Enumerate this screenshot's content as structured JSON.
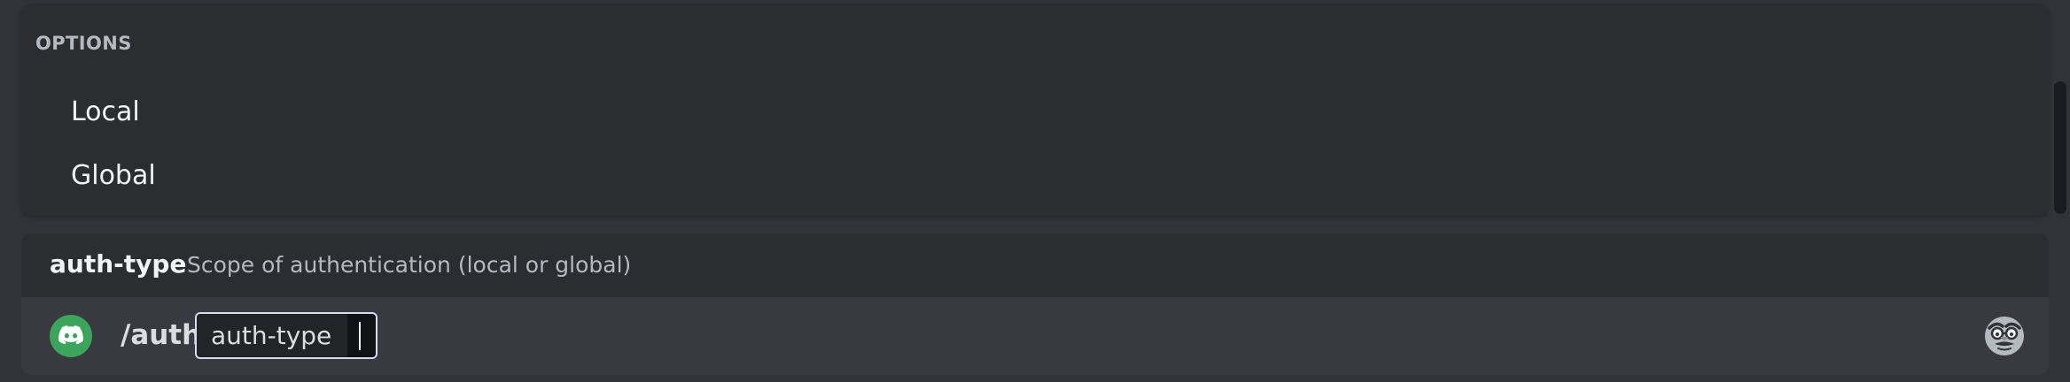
{
  "options": {
    "header": "OPTIONS",
    "items": [
      {
        "label": "Local"
      },
      {
        "label": "Global"
      }
    ]
  },
  "hint": {
    "option_name": "auth-type",
    "description": "Scope of authentication (local or global)"
  },
  "input": {
    "app_icon": "discord-icon",
    "command": "/auth",
    "param_name": "auth-type",
    "param_value": "",
    "emoji_icon": "disguised-face-icon"
  },
  "colors": {
    "background": "#313338",
    "panel": "#2b2d31",
    "input_bar": "#383a40",
    "app_icon_bg": "#3ba55c",
    "pill_border": "#d7dbf5"
  }
}
